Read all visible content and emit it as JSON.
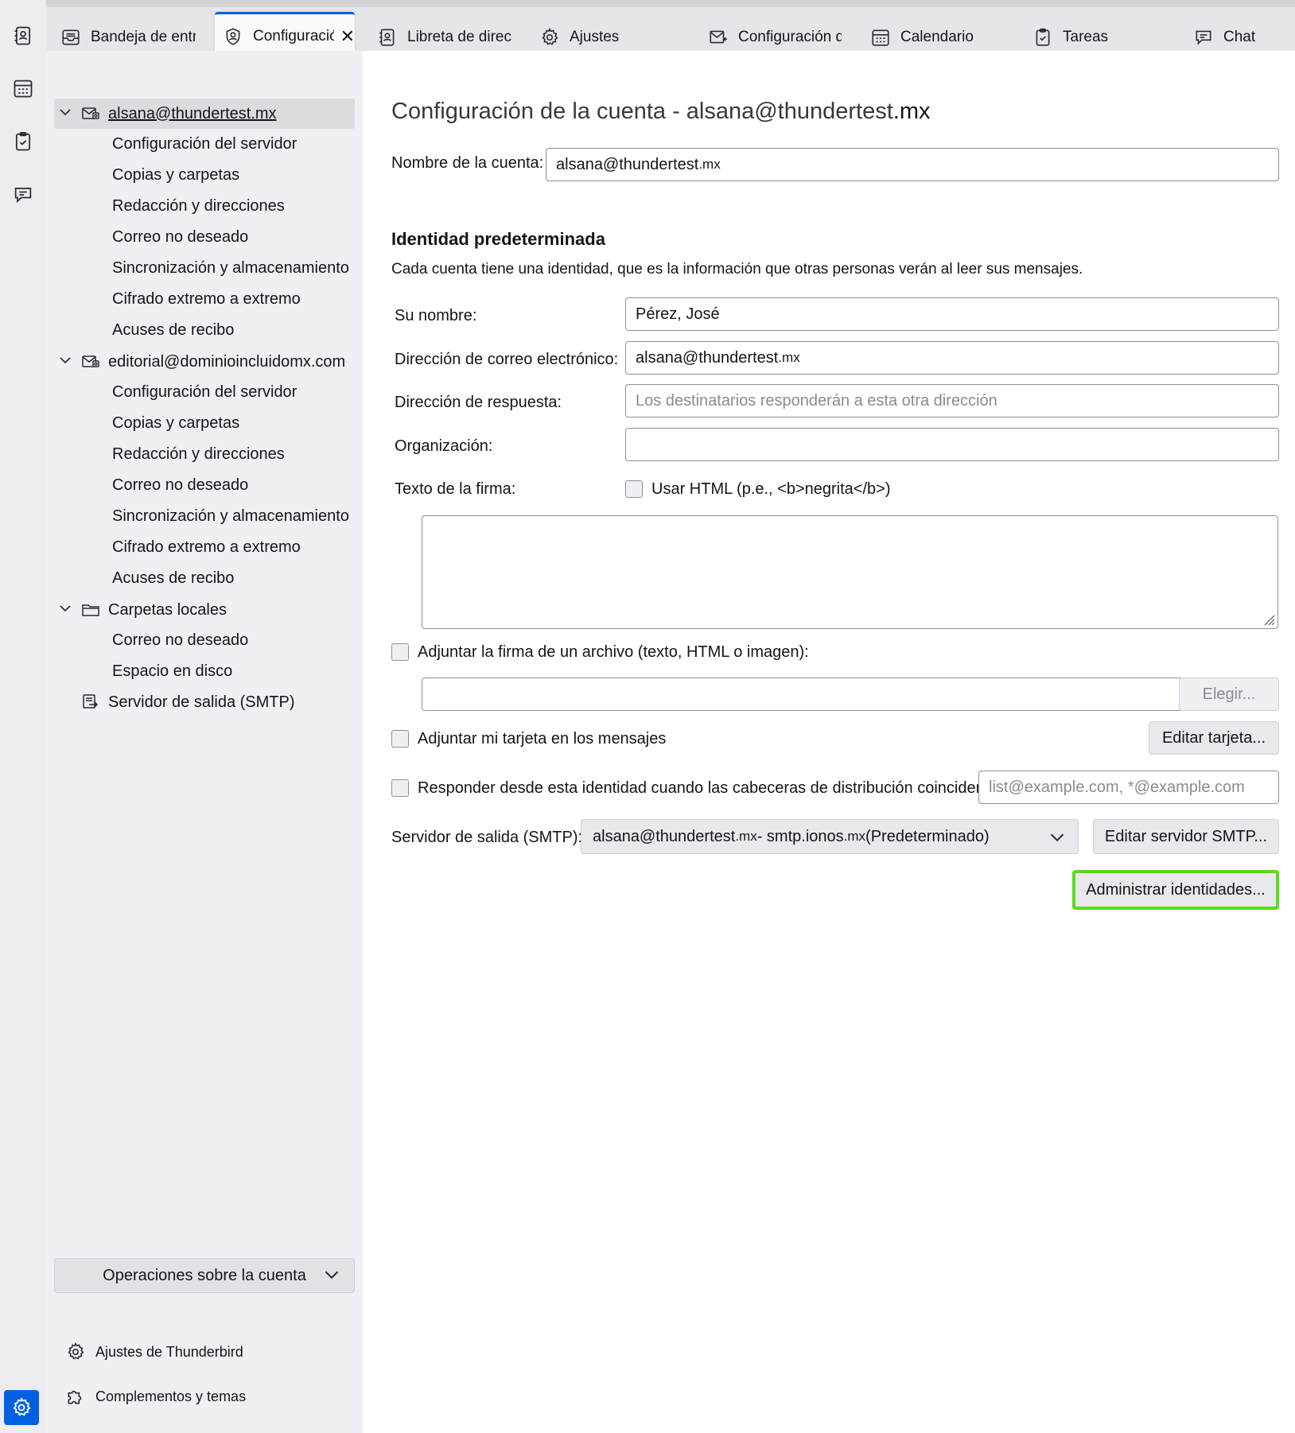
{
  "tabs": [
    {
      "label": "Bandeja de entrada",
      "icon": "inbox-icon"
    },
    {
      "label": "Configuración",
      "icon": "account-settings-icon",
      "close": "✕"
    },
    {
      "label": "Libreta de direcciones",
      "icon": "address-book-icon"
    },
    {
      "label": "Ajustes",
      "icon": "gear-icon"
    },
    {
      "label": "Configuración de",
      "icon": "mail-config-icon"
    },
    {
      "label": "Calendario",
      "icon": "calendar-icon"
    },
    {
      "label": "Tareas",
      "icon": "tasks-icon"
    },
    {
      "label": "Chat",
      "icon": "chat-icon"
    }
  ],
  "spaces": [
    "address-book-icon",
    "calendar-icon",
    "tasks-icon",
    "chat-icon",
    "settings-icon"
  ],
  "sidebar": {
    "accounts": [
      {
        "name": "alsana@thundertest.mx",
        "items": [
          "Configuración del servidor",
          "Copias y carpetas",
          "Redacción y direcciones",
          "Correo no deseado",
          "Sincronización y almacenamiento",
          "Cifrado extremo a extremo",
          "Acuses de recibo"
        ]
      },
      {
        "name": "editorial@dominioincluidomx.com",
        "items": [
          "Configuración del servidor",
          "Copias y carpetas",
          "Redacción y direcciones",
          "Correo no deseado",
          "Sincronización y almacenamiento",
          "Cifrado extremo a extremo",
          "Acuses de recibo"
        ]
      },
      {
        "name": "Carpetas locales",
        "items": [
          "Correo no deseado",
          "Espacio en disco"
        ]
      }
    ],
    "smtp": "Servidor de salida (SMTP)",
    "account_ops": "Operaciones sobre la cuenta",
    "thunderbird_settings": "Ajustes de Thunderbird",
    "addons": "Complementos y temas"
  },
  "main": {
    "title_prefix": "Configuración de la cuenta - alsana@thundertest",
    "title_suffix": ".mx",
    "account_name_label": "Nombre de la cuenta:",
    "account_name_value_a": "alsana@thundertest",
    "account_name_value_b": ".mx",
    "identity_heading": "Identidad predeterminada",
    "identity_desc": "Cada cuenta tiene una identidad, que es la información que otras personas verán al leer sus mensajes.",
    "name_label": "Su nombre:",
    "name_value": "Pérez, José",
    "email_label": "Dirección de correo electrónico:",
    "email_value_a": "alsana@thundertest",
    "email_value_b": ".mx",
    "reply_label": "Dirección de respuesta:",
    "reply_placeholder": "Los destinatarios responderán a esta otra dirección",
    "org_label": "Organización:",
    "org_value": "",
    "signature_label": "Texto de la firma:",
    "use_html_label": "Usar HTML (p.e., <b>negrita</b>)",
    "attach_sig_label": "Adjuntar la firma de un archivo (texto, HTML o imagen):",
    "choose_button": "Elegir...",
    "attach_card_label": "Adjuntar mi tarjeta en los mensajes",
    "edit_card_button": "Editar tarjeta...",
    "reply_from_label": "Responder desde esta identidad cuando las cabeceras de distribución coinciden:",
    "reply_from_placeholder": "list@example.com, *@example.com",
    "smtp_label": "Servidor de salida (SMTP):",
    "smtp_value_a": "alsana@thundertest",
    "smtp_value_b": ".mx",
    "smtp_value_c": " - smtp.ionos",
    "smtp_value_d": ".mx",
    "smtp_value_e": "(Predeterminado)",
    "edit_smtp_button": "Editar servidor SMTP...",
    "manage_identities_button": "Administrar identidades..."
  }
}
